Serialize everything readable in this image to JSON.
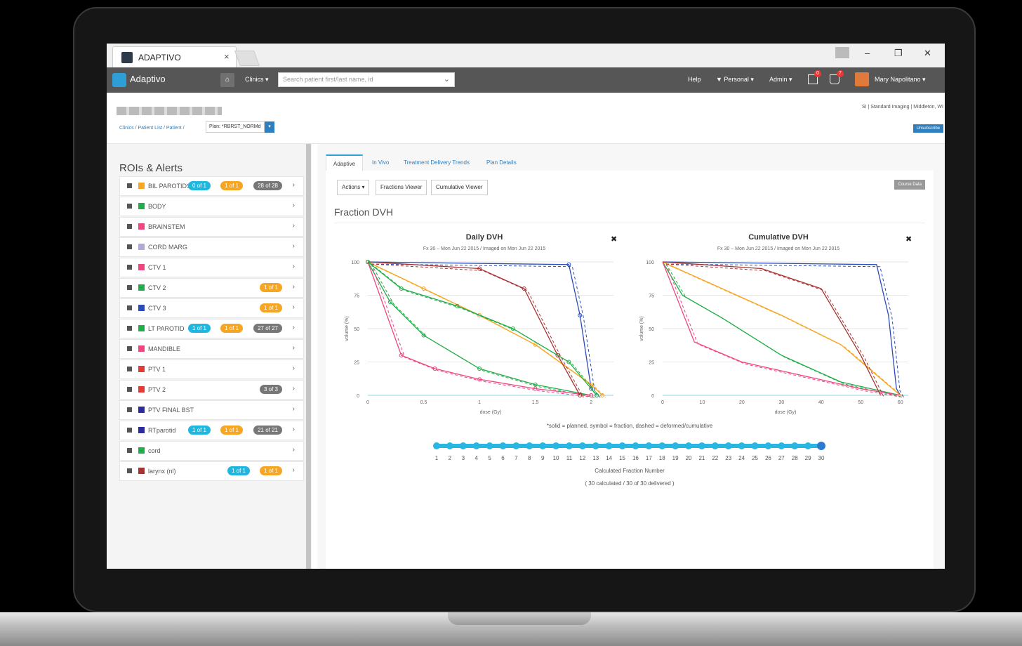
{
  "browser": {
    "tab_title": "ADAPTIVO",
    "tab_close": "×",
    "min": "–",
    "restore": "❐",
    "close": "✕"
  },
  "nav": {
    "brand": "Adaptivo",
    "clinics": "Clinics ▾",
    "search_placeholder": "Search patient first/last name, id",
    "help": "Help",
    "personal": "▼ Personal ▾",
    "admin": "Admin ▾",
    "msg_count": "0",
    "alert_count": "7",
    "user": "Mary Napolitano ▾"
  },
  "header": {
    "breadcrumb": "Clinics  /  Patient List  /  Patient  /",
    "plan": "Plan: *RBRST_NORMd",
    "clinic": "SI | Standard Imaging | Middleton, WI",
    "unsubscribe": "Unsubscribe"
  },
  "sidebar": {
    "title": "ROIs & Alerts",
    "rois": [
      {
        "name": "BIL PAROTIDS",
        "color": "#f6a623",
        "pills": [
          [
            "0 of 1",
            "#1fb7e0"
          ],
          [
            "1 of 1",
            "#f6a623"
          ],
          [
            "28 of 28",
            "#777"
          ]
        ]
      },
      {
        "name": "BODY",
        "color": "#1fae47",
        "pills": []
      },
      {
        "name": "BRAINSTEM",
        "color": "#f0457f",
        "pills": []
      },
      {
        "name": "CORD MARG",
        "color": "#b2a7d9",
        "pills": []
      },
      {
        "name": "CTV 1",
        "color": "#f0457f",
        "pills": []
      },
      {
        "name": "CTV 2",
        "color": "#1fae47",
        "pills": [
          [
            "1 of 1",
            "#f6a623"
          ]
        ]
      },
      {
        "name": "CTV 3",
        "color": "#2b4cb8",
        "pills": [
          [
            "1 of 1",
            "#f6a623"
          ]
        ]
      },
      {
        "name": "LT PAROTID",
        "color": "#1fae47",
        "pills": [
          [
            "1 of 1",
            "#1fb7e0"
          ],
          [
            "1 of 1",
            "#f6a623"
          ],
          [
            "27 of 27",
            "#777"
          ]
        ]
      },
      {
        "name": "MANDIBLE",
        "color": "#f0457f",
        "pills": []
      },
      {
        "name": "PTV 1",
        "color": "#e53935",
        "pills": []
      },
      {
        "name": "PTV 2",
        "color": "#e53935",
        "pills": [
          [
            "3 of 3",
            "#777"
          ]
        ]
      },
      {
        "name": "PTV FINAL BST",
        "color": "#2b2b9b",
        "pills": []
      },
      {
        "name": "RTparotid",
        "color": "#2b2b9b",
        "pills": [
          [
            "1 of 1",
            "#1fb7e0"
          ],
          [
            "1 of 1",
            "#f6a623"
          ],
          [
            "21 of 21",
            "#777"
          ]
        ]
      },
      {
        "name": "cord",
        "color": "#1fae47",
        "pills": []
      },
      {
        "name": "larynx (nl)",
        "color": "#a83232",
        "pills": [
          [
            "1 of 1",
            "#1fb7e0"
          ],
          [
            "1 of 1",
            "#f6a623"
          ]
        ]
      }
    ]
  },
  "main": {
    "tabs": [
      "Adaptive",
      "In Vivo",
      "Treatment Delivery Trends",
      "Plan Details"
    ],
    "actions": "Actions ▾",
    "fractions_viewer": "Fractions Viewer",
    "cumulative_viewer": "Cumulative Viewer",
    "course_data": "Course Data",
    "section_title": "Fraction DVH",
    "legend": "*solid = planned, symbol = fraction, dashed = deformed/cumulative",
    "calc_label": "Calculated Fraction Number",
    "calc_sub": "( 30 calculated / 30 of 30 delivered )"
  },
  "chart_data": [
    {
      "type": "line",
      "title": "Daily DVH",
      "subtitle": "Fx 30 – Mon Jun 22 2015 / Imaged on Mon Jun 22 2015",
      "xlabel": "dose (Gy)",
      "ylabel": "volume (%)",
      "xlim": [
        0,
        2.2
      ],
      "ylim": [
        0,
        100
      ],
      "xticks": [
        "0",
        "0.5",
        "1",
        "1.5",
        "2"
      ],
      "yticks": [
        "0",
        "25",
        "50",
        "75",
        "100"
      ],
      "series": [
        {
          "color": "#2b4cb8",
          "points": [
            [
              0,
              100
            ],
            [
              1.8,
              98
            ],
            [
              1.9,
              60
            ],
            [
              2,
              5
            ],
            [
              2.05,
              0
            ]
          ]
        },
        {
          "color": "#1fae47",
          "points": [
            [
              0,
              100
            ],
            [
              0.2,
              70
            ],
            [
              0.5,
              45
            ],
            [
              1,
              20
            ],
            [
              1.5,
              8
            ],
            [
              2,
              0
            ]
          ]
        },
        {
          "color": "#f0457f",
          "points": [
            [
              0,
              100
            ],
            [
              0.3,
              30
            ],
            [
              0.6,
              20
            ],
            [
              1,
              12
            ],
            [
              1.5,
              5
            ],
            [
              2,
              0
            ]
          ]
        },
        {
          "color": "#f6a623",
          "points": [
            [
              0,
              100
            ],
            [
              0.5,
              80
            ],
            [
              1,
              60
            ],
            [
              1.5,
              38
            ],
            [
              2,
              8
            ],
            [
              2.1,
              0
            ]
          ]
        },
        {
          "color": "#a83232",
          "points": [
            [
              0,
              100
            ],
            [
              1,
              95
            ],
            [
              1.4,
              80
            ],
            [
              1.7,
              30
            ],
            [
              1.9,
              0
            ]
          ]
        },
        {
          "color": "#1fae47",
          "points": [
            [
              0,
              100
            ],
            [
              0.3,
              80
            ],
            [
              0.8,
              67
            ],
            [
              1.3,
              50
            ],
            [
              1.8,
              25
            ],
            [
              2.05,
              0
            ]
          ]
        }
      ]
    },
    {
      "type": "line",
      "title": "Cumulative DVH",
      "subtitle": "Fx 30 – Mon Jun 22 2015 / Imaged on Mon Jun 22 2015",
      "xlabel": "dose (Gy)",
      "ylabel": "volume (%)",
      "xlim": [
        0,
        62
      ],
      "ylim": [
        0,
        100
      ],
      "xticks": [
        "0",
        "10",
        "20",
        "30",
        "40",
        "50",
        "60"
      ],
      "yticks": [
        "0",
        "25",
        "50",
        "75",
        "100"
      ],
      "series": [
        {
          "color": "#2b4cb8",
          "points": [
            [
              0,
              100
            ],
            [
              54,
              98
            ],
            [
              57,
              60
            ],
            [
              59,
              5
            ],
            [
              60,
              0
            ]
          ]
        },
        {
          "color": "#1fae47",
          "points": [
            [
              0,
              100
            ],
            [
              5,
              75
            ],
            [
              15,
              58
            ],
            [
              30,
              30
            ],
            [
              45,
              10
            ],
            [
              60,
              0
            ]
          ]
        },
        {
          "color": "#f0457f",
          "points": [
            [
              0,
              100
            ],
            [
              8,
              40
            ],
            [
              20,
              25
            ],
            [
              35,
              15
            ],
            [
              50,
              5
            ],
            [
              60,
              0
            ]
          ]
        },
        {
          "color": "#f6a623",
          "points": [
            [
              0,
              100
            ],
            [
              15,
              80
            ],
            [
              30,
              60
            ],
            [
              45,
              38
            ],
            [
              58,
              5
            ],
            [
              60,
              0
            ]
          ]
        },
        {
          "color": "#a83232",
          "points": [
            [
              0,
              100
            ],
            [
              25,
              95
            ],
            [
              40,
              80
            ],
            [
              50,
              30
            ],
            [
              55,
              0
            ]
          ]
        }
      ]
    }
  ],
  "fractions": [
    "1",
    "2",
    "3",
    "4",
    "5",
    "6",
    "7",
    "8",
    "9",
    "10",
    "11",
    "12",
    "13",
    "14",
    "15",
    "16",
    "17",
    "18",
    "19",
    "20",
    "21",
    "22",
    "23",
    "24",
    "25",
    "26",
    "27",
    "28",
    "29",
    "30"
  ]
}
